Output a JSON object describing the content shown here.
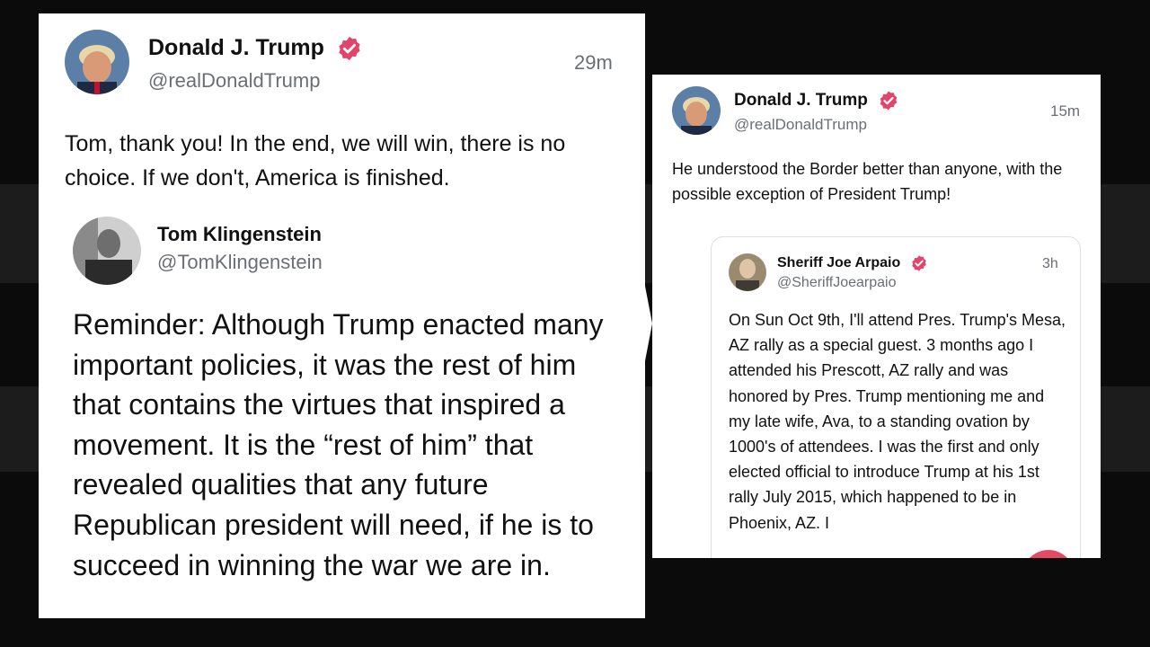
{
  "left_post": {
    "author": {
      "name": "Donald J. Trump",
      "handle": "@realDonaldTrump",
      "time": "29m"
    },
    "text": "Tom, thank you! In the end, we will win, there is no choice. If we don't, America is finished.",
    "quoted": {
      "name": "Tom Klingenstein",
      "handle": "@TomKlingenstein",
      "text": "Reminder: Although Trump enacted many important policies, it was the rest of him that contains the virtues that inspired a movement. It is the “rest of him” that revealed qualities that any future Republican president will need, if he is to succeed in winning the war we are in."
    }
  },
  "right_post": {
    "author": {
      "name": "Donald J. Trump",
      "handle": "@realDonaldTrump",
      "time": "15m"
    },
    "text": "He understood the Border better than anyone, with the possible exception of President Trump!",
    "quoted": {
      "name": "Sheriff Joe Arpaio",
      "handle": "@SheriffJoearpaio",
      "time": "3h",
      "text": "On Sun Oct 9th, I'll attend Pres. Trump's Mesa, AZ rally as a special guest. 3 months ago I attended his Prescott, AZ rally and was honored by Pres. Trump mentioning me and my late wife, Ava, to a standing ovation by 1000's of attendees. I was the first and only elected official to introduce Trump at his 1st rally July 2015, which happened to be in Phoenix, AZ. I"
    }
  },
  "colors": {
    "verified_badge": "#e2456b",
    "fab": "#e24b63",
    "handle_gray": "#6b6f74"
  },
  "icons": {
    "verified": "verified-badge-icon"
  }
}
